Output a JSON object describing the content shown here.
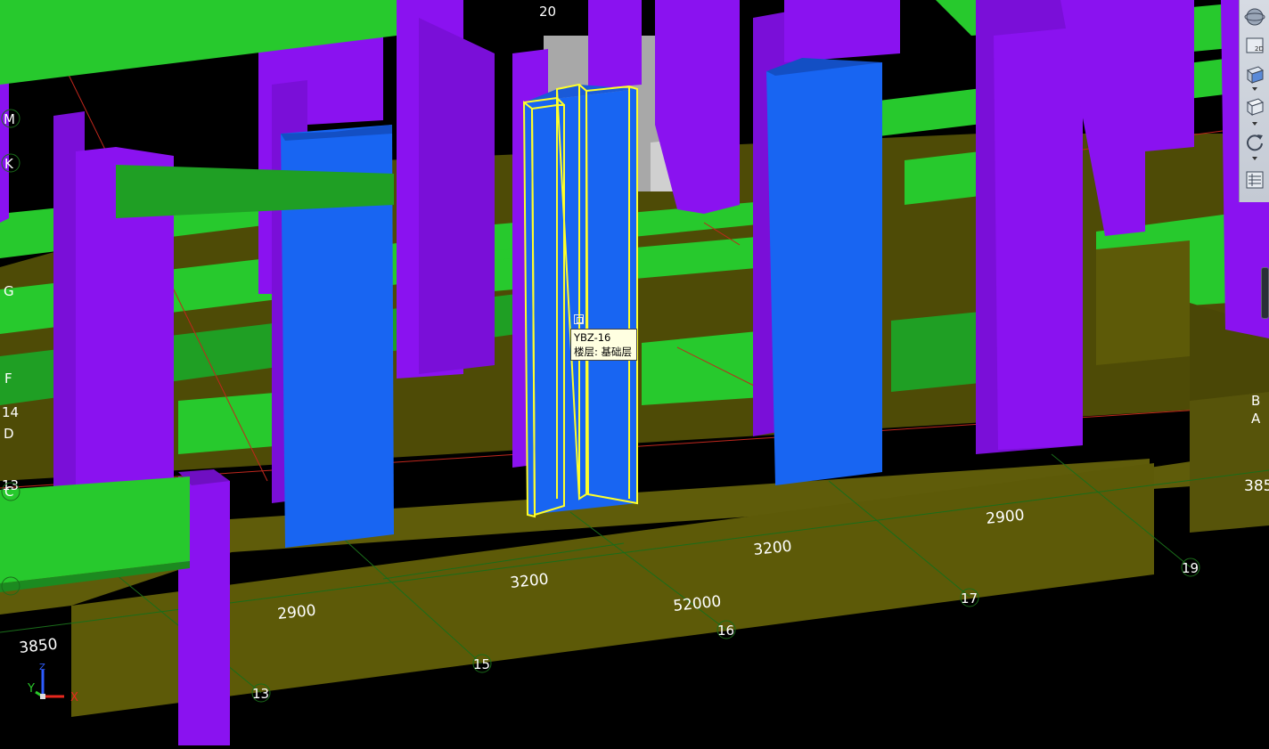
{
  "scene": {
    "grid_labels_bottom": [
      "13",
      "15",
      "16",
      "17",
      "19"
    ],
    "grid_label_top": "20",
    "grid_labels_left": [
      "M",
      "K",
      "G",
      "F",
      "14",
      "D",
      "13",
      "C"
    ],
    "grid_labels_right": [
      "B",
      "A"
    ],
    "dimensions": {
      "d3850_left": "3850",
      "d2900_a": "2900",
      "d3200_a": "3200",
      "d52000": "52000",
      "d3200_b": "3200",
      "d2900_b": "2900",
      "d3850_right": "385"
    },
    "colors": {
      "beam": "#27c92d",
      "column": "#8a12f0",
      "wall": "#1865f2",
      "slab": "#5d5a08",
      "selection": "#ffff2a",
      "axis_line": "#c0271d",
      "grid_line": "#1a6d1a"
    }
  },
  "tooltip": {
    "line1": "YBZ-16",
    "line2": "楼层: 基础层"
  },
  "axes_triad": {
    "x": "X",
    "y": "Y",
    "z": "Z"
  },
  "toolbar": {
    "buttons": [
      {
        "name": "orbit-icon"
      },
      {
        "name": "view-2d-icon",
        "label": "2D"
      },
      {
        "name": "view-3d-box-icon"
      },
      {
        "name": "display-cube-icon"
      },
      {
        "name": "rotate-icon"
      },
      {
        "name": "layer-panel-icon"
      }
    ]
  }
}
